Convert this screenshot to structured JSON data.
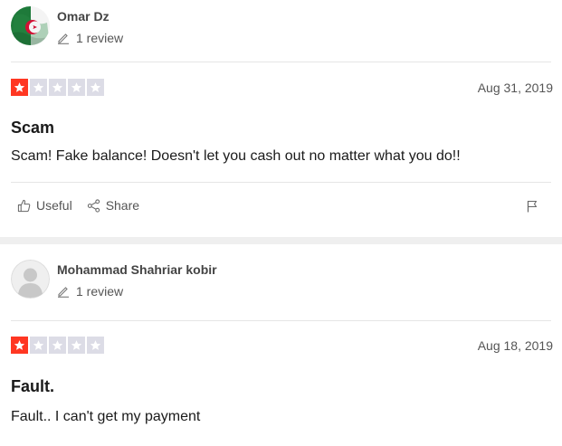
{
  "reviews": [
    {
      "user_name": "Omar Dz",
      "review_count": "1 review",
      "avatar_icon": "algeria-flag-avatar",
      "rating": 1,
      "max_rating": 5,
      "date": "Aug 31, 2019",
      "title": "Scam",
      "body": "Scam! Fake balance! Doesn't let you cash out no matter what you do!!",
      "useful_label": "Useful",
      "share_label": "Share",
      "flag_icon": "flag-icon"
    },
    {
      "user_name": "Mohammad Shahriar kobir",
      "review_count": "1 review",
      "avatar_icon": "default-user-avatar",
      "rating": 1,
      "max_rating": 5,
      "date": "Aug 18, 2019",
      "title": "Fault.",
      "body": "Fault.. I can't get my payment"
    }
  ],
  "colors": {
    "star_filled": "#ff3722",
    "star_empty": "#dcdce6",
    "divider_band": "#efefef"
  }
}
